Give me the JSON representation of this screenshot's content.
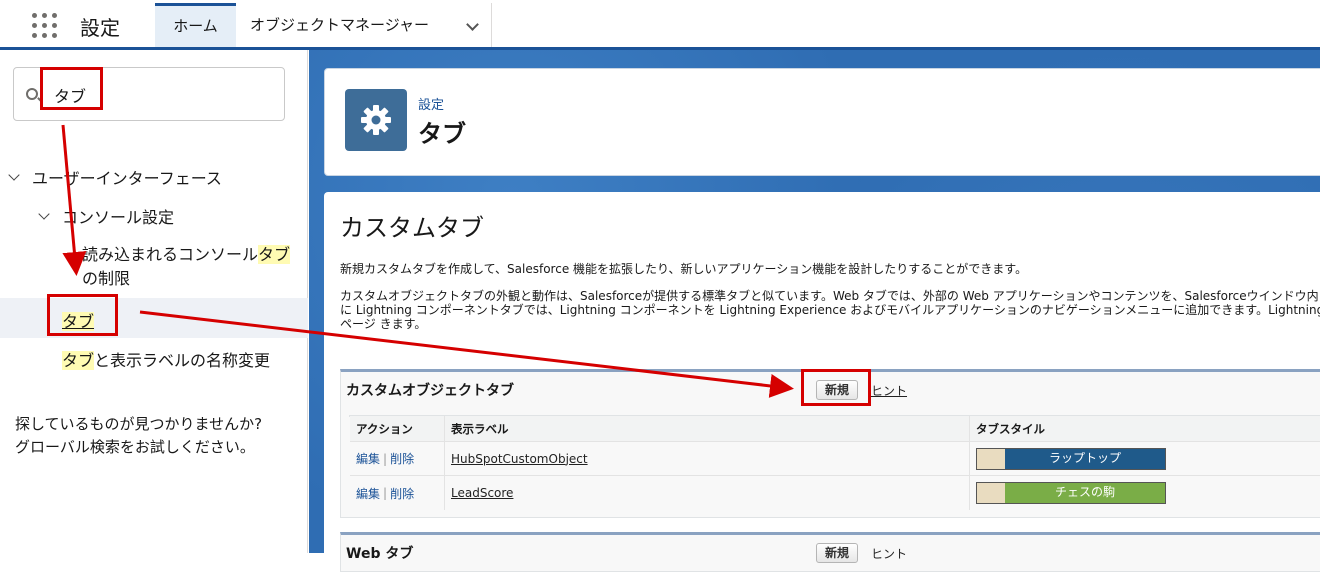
{
  "header": {
    "app_title": "設定",
    "tabs": [
      {
        "label": "ホーム"
      },
      {
        "label": "オブジェクトマネージャー"
      }
    ]
  },
  "sidebar": {
    "search_value": "タブ",
    "tree": {
      "ui_label": "ユーザーインターフェース",
      "console_label": "コンソール設定",
      "loaded_prefix": "読み込まれるコンソール",
      "loaded_highlight": "タブ",
      "loaded_suffix": "の制限",
      "tabs_item": "タブ",
      "rename_highlight": "タブ",
      "rename_suffix": "と表示ラベルの名称変更"
    },
    "help_line1": "探しているものが見つかりませんか?",
    "help_line2": "グローバル検索をお試しください。"
  },
  "page_header": {
    "breadcrumb": "設定",
    "title": "タブ"
  },
  "main": {
    "title": "カスタムタブ",
    "desc1": "新規カスタムタブを作成して、Salesforce 機能を拡張したり、新しいアプリケーション機能を設計したりすることができます。",
    "desc2": "カスタムオブジェクトタブの外観と動作は、Salesforceが提供する標準タブと似ています。Web タブでは、外部の Web アプリケーションやコンテンツを、Salesforceウインドウ内に Lightning コンポーネントタブでは、Lightning コンポーネントを Lightning Experience およびモバイルアプリケーションのナビゲーションメニューに追加できます。Lightning ページ きます。",
    "custom_object_section": {
      "title": "カスタムオブジェクトタブ",
      "new_button": "新規",
      "hint": "ヒント",
      "columns": [
        "アクション",
        "表示ラベル",
        "タブスタイル"
      ],
      "rows": [
        {
          "edit": "編集",
          "delete": "削除",
          "label": "HubSpotCustomObject",
          "style": "ラップトップ",
          "color": "#1f5a8a"
        },
        {
          "edit": "編集",
          "delete": "削除",
          "label": "LeadScore",
          "style": "チェスの駒",
          "color": "#7aad47"
        }
      ]
    },
    "web_section": {
      "title": "Web タブ",
      "new_button": "新規",
      "hint": "ヒント"
    }
  }
}
